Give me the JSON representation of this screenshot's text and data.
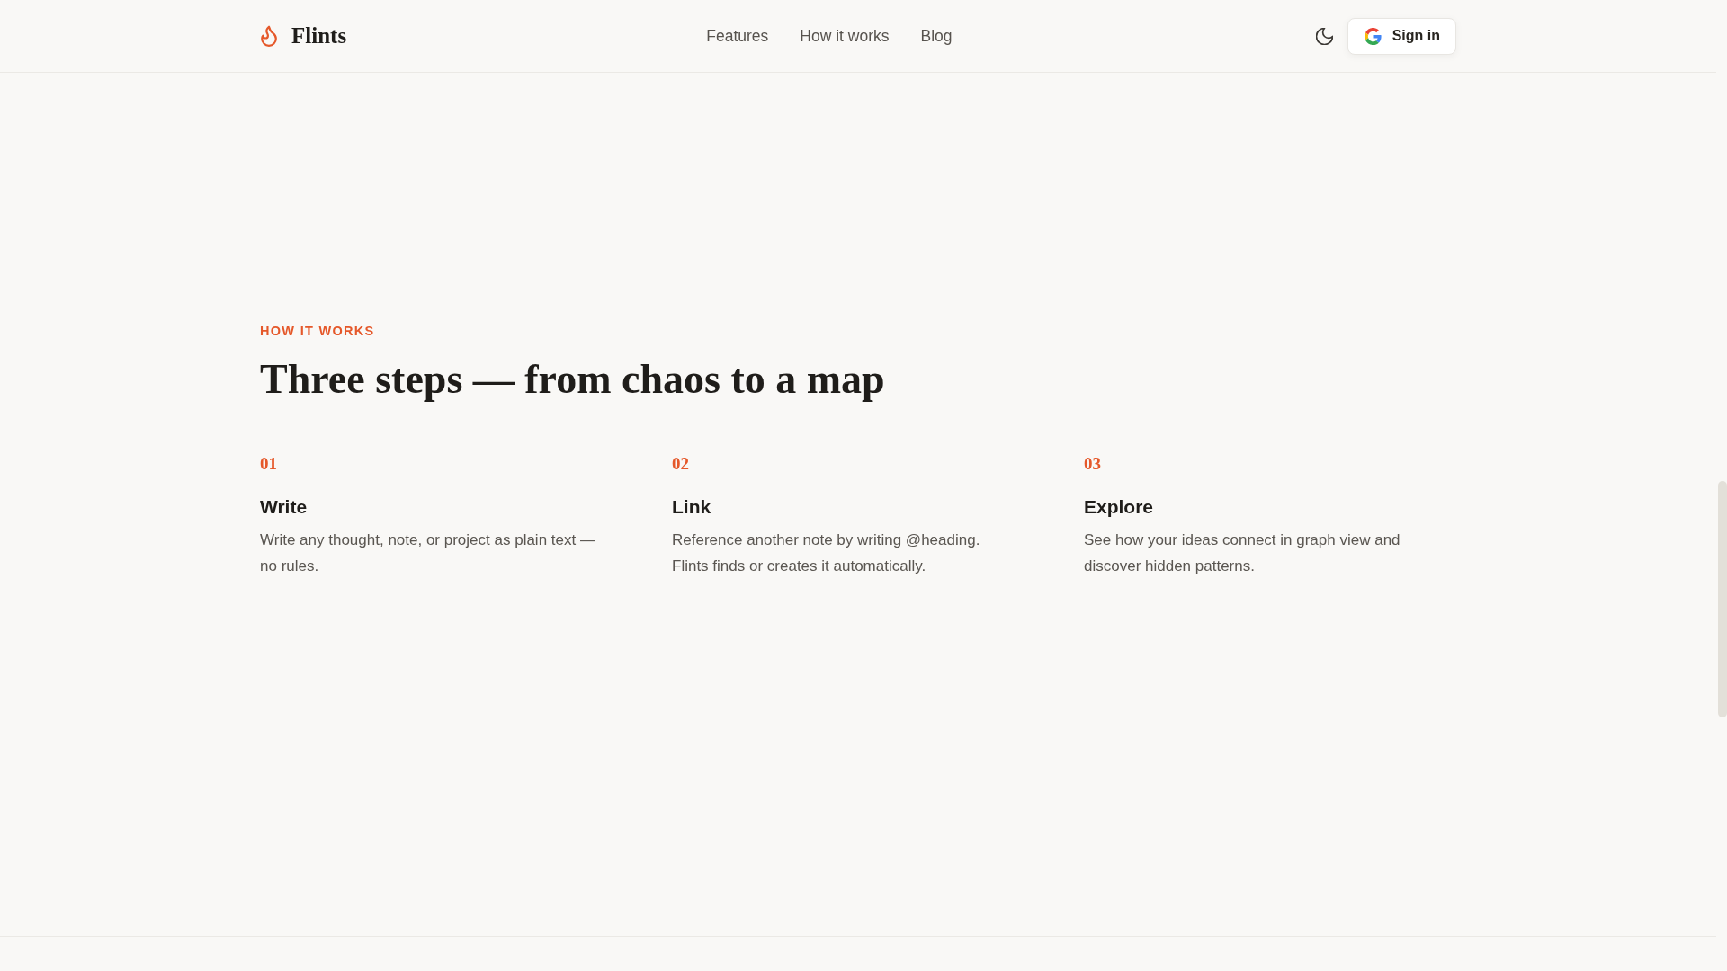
{
  "header": {
    "brand": "Flints",
    "nav": [
      "Features",
      "How it works",
      "Blog"
    ],
    "sign_in": "Sign in"
  },
  "section": {
    "eyebrow": "HOW IT WORKS",
    "title": "Three steps — from chaos to a map",
    "steps": [
      {
        "number": "01",
        "title": "Write",
        "description": "Write any thought, note, or project as plain text — no rules."
      },
      {
        "number": "02",
        "title": "Link",
        "description": "Reference another note by writing @heading. Flints finds or creates it automatically."
      },
      {
        "number": "03",
        "title": "Explore",
        "description": "See how your ideas connect in graph view and discover hidden patterns."
      }
    ]
  }
}
